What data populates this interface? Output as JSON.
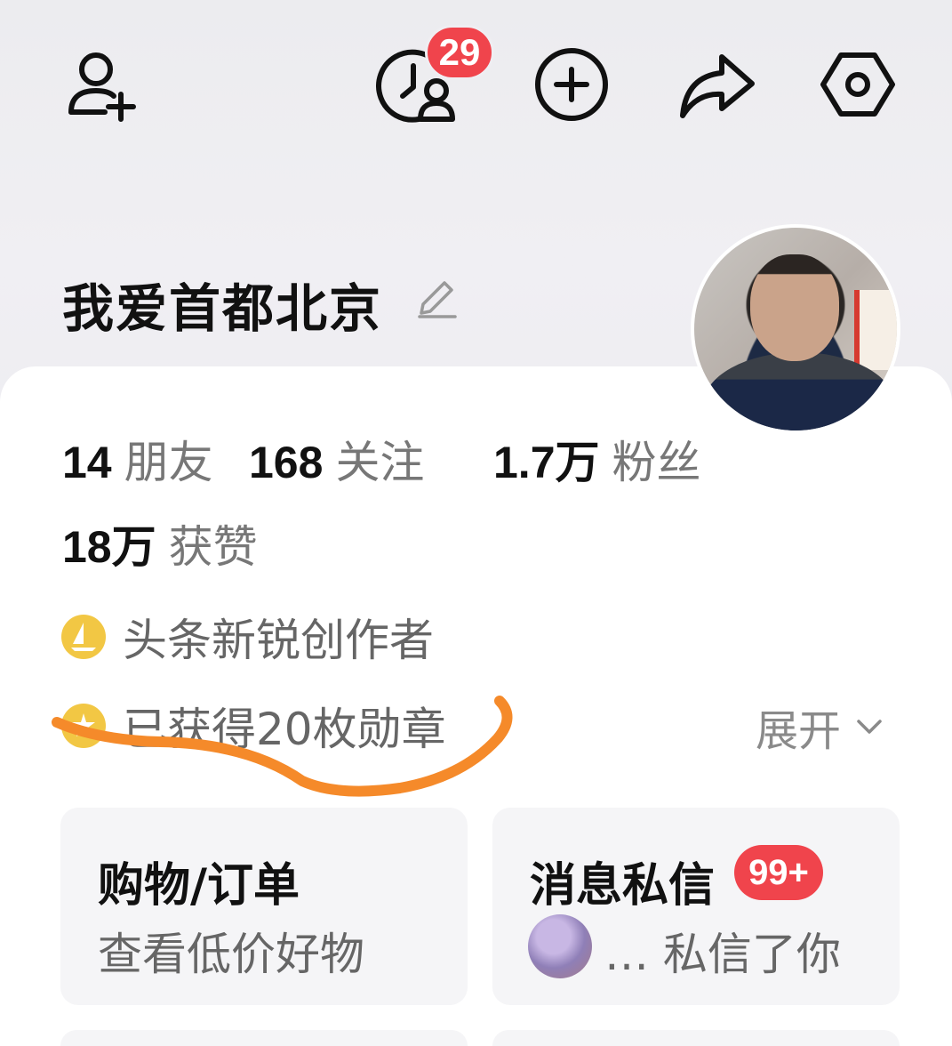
{
  "header": {
    "visitors_badge": "29"
  },
  "profile": {
    "username": "我爱首都北京",
    "stats": [
      {
        "num": "14",
        "label": "朋友"
      },
      {
        "num": "168",
        "label": "关注"
      },
      {
        "num": "1.7万",
        "label": "粉丝"
      },
      {
        "num": "18万",
        "label": "获赞"
      }
    ],
    "creator_title": "头条新锐创作者",
    "medals_text": "已获得20枚勋章",
    "expand_label": "展开"
  },
  "tiles": {
    "shopping": {
      "title": "购物/订单",
      "subtitle": "查看低价好物"
    },
    "messages": {
      "title": "消息私信",
      "badge": "99+",
      "preview": "… 私信了你"
    }
  },
  "colors": {
    "badge_red": "#f0444c",
    "annotation_orange": "#f58a2a",
    "medal_gold": "#f2c744"
  }
}
